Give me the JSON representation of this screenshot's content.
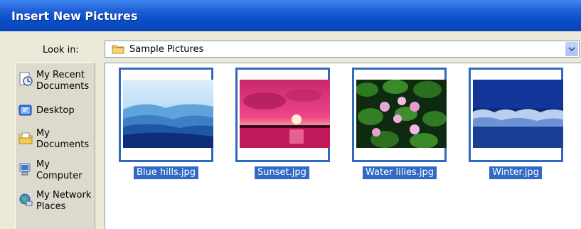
{
  "dialog": {
    "title": "Insert New Pictures"
  },
  "look_in": {
    "label": "Look in:",
    "value": "Sample Pictures",
    "folder_icon": "folder-icon",
    "dropdown_icon": "chevron-down-icon"
  },
  "places": [
    {
      "label": "My Recent\nDocuments",
      "icon": "recent-documents-icon"
    },
    {
      "label": "Desktop",
      "icon": "desktop-icon"
    },
    {
      "label": "My\nDocuments",
      "icon": "my-documents-icon"
    },
    {
      "label": "My\nComputer",
      "icon": "my-computer-icon"
    },
    {
      "label": "My Network\nPlaces",
      "icon": "network-places-icon"
    }
  ],
  "files": [
    {
      "name": "Blue hills.jpg",
      "thumb": "blue-hills-thumbnail"
    },
    {
      "name": "Sunset.jpg",
      "thumb": "sunset-thumbnail"
    },
    {
      "name": "Water lilies.jpg",
      "thumb": "water-lilies-thumbnail"
    },
    {
      "name": "Winter.jpg",
      "thumb": "winter-thumbnail"
    }
  ],
  "colors": {
    "titlebar": "#0A45B8",
    "selection": "#316AC5",
    "dialog_bg": "#ECE9D8",
    "places_bg": "#DDDACD"
  }
}
